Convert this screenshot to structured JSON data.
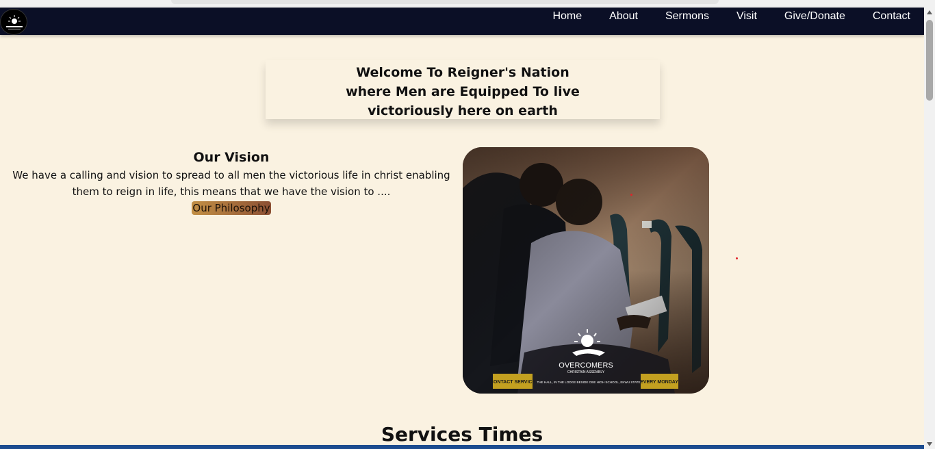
{
  "nav": {
    "logo_icon": "church-logo-icon",
    "links": [
      "Home",
      "About",
      "Sermons",
      "Visit",
      "Give/Donate",
      "Contact"
    ]
  },
  "hero": {
    "welcome": "Welcome To Reigner's Nation where Men are Equipped To live victoriously here on earth"
  },
  "vision": {
    "title": "Our Vision",
    "text": "We have a calling and vision to spread to all men the victorious life in christ enabling them to reign in life, this means that we have the vision to ....",
    "button": "Our Philosophy"
  },
  "photo": {
    "brand": "OVERCOMERS",
    "brand_sub": "CHRISTAIN ASSEMBLY",
    "banner_left": "CONTACT SERVICE",
    "banner_mid": "THE HALL, IN THE LODGE BESIDE OBE HIGH SCHOOL, EKWU STATE",
    "banner_right": "EVERY MONDAY"
  },
  "services": {
    "title": "Services Times"
  },
  "colors": {
    "navbar": "#0b0f26",
    "background": "#faf2e1",
    "accent_button": "#a56d3b"
  }
}
